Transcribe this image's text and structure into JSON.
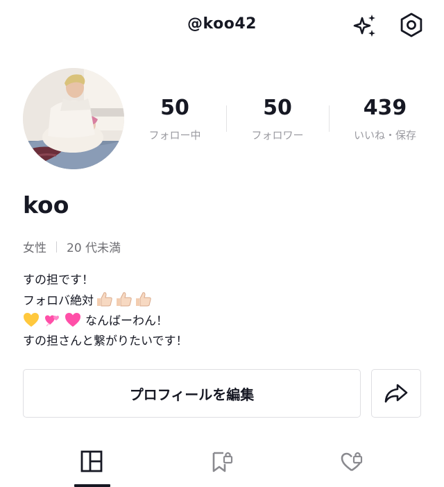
{
  "header": {
    "username": "@koo42",
    "icons": {
      "sparkle": "sparkle-icon",
      "settings": "settings-icon"
    }
  },
  "profile": {
    "avatar": "avatar",
    "stats": [
      {
        "value": "50",
        "label": "フォロー中"
      },
      {
        "value": "50",
        "label": "フォロワー"
      },
      {
        "value": "439",
        "label": "いいね・保存"
      }
    ],
    "name": "koo",
    "gender": "女性",
    "age": "20 代未満"
  },
  "bio": {
    "line1": "すの担です！",
    "line2": "フォロバ絶対",
    "line3": "なんばーわん！",
    "line4": "すの担さんと繋がりたいです！"
  },
  "actions": {
    "edit_label": "プロフィールを編集",
    "share_icon": "share-icon"
  },
  "tabs": [
    {
      "icon": "grid-icon",
      "selected": true
    },
    {
      "icon": "saved-lock-icon",
      "selected": false
    },
    {
      "icon": "liked-lock-icon",
      "selected": false
    }
  ],
  "colors": {
    "text": "#161823",
    "muted": "#9a9aa0",
    "border": "#dedee2",
    "heart_pink": "#ff4fa8",
    "heart_yellow": "#ffc83d"
  }
}
